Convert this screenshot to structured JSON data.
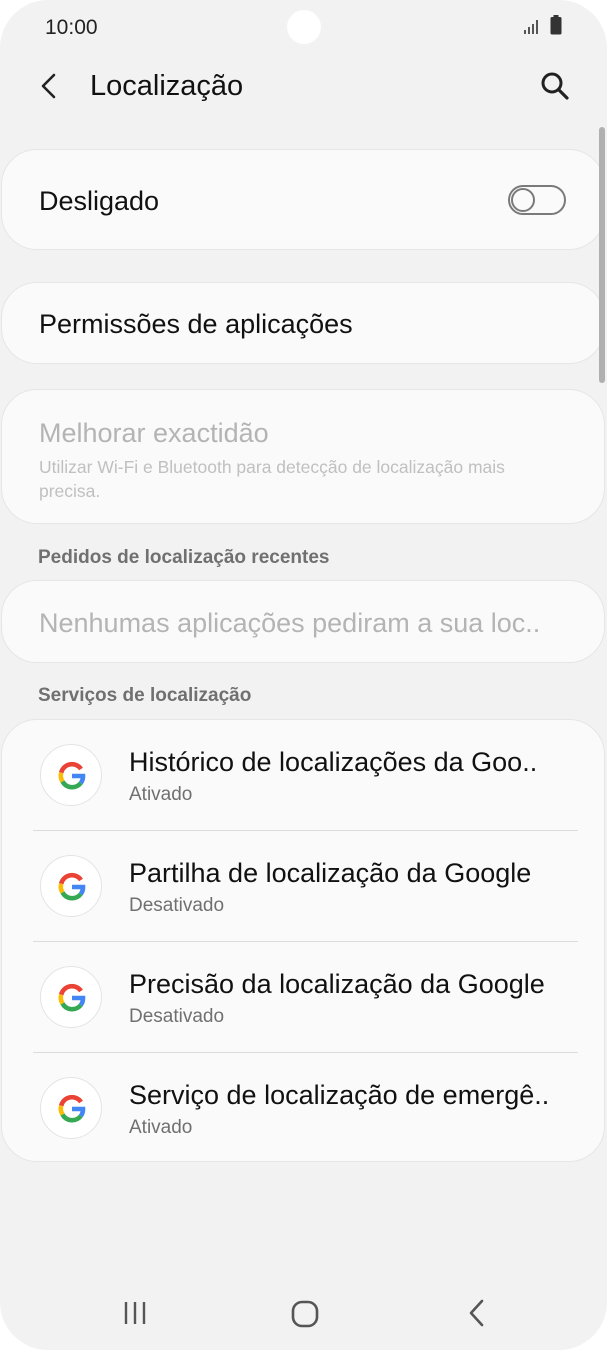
{
  "status_bar": {
    "time": "10:00"
  },
  "header": {
    "title": "Localização"
  },
  "location_toggle": {
    "label": "Desligado",
    "state": "off"
  },
  "app_permissions": {
    "label": "Permissões de aplicações"
  },
  "improve_accuracy": {
    "title": "Melhorar exactidão",
    "description": "Utilizar Wi-Fi e Bluetooth para detecção de localização mais precisa."
  },
  "recent_requests": {
    "header": "Pedidos de localização recentes",
    "empty_text": "Nenhumas aplicações pediram a sua loc.."
  },
  "location_services": {
    "header": "Serviços de localização",
    "items": [
      {
        "title": "Histórico de localizações da Goo..",
        "status": "Ativado",
        "icon": "google-icon"
      },
      {
        "title": "Partilha de localização da Google",
        "status": "Desativado",
        "icon": "google-icon"
      },
      {
        "title": "Precisão da localização da Google",
        "status": "Desativado",
        "icon": "google-icon"
      },
      {
        "title": "Serviço de localização de emergê..",
        "status": "Ativado",
        "icon": "google-icon"
      }
    ]
  },
  "colors": {
    "background": "#f2f2f2",
    "card": "#fafafa",
    "google_blue": "#4285F4",
    "google_red": "#EA4335",
    "google_yellow": "#FBBC05",
    "google_green": "#34A853"
  }
}
